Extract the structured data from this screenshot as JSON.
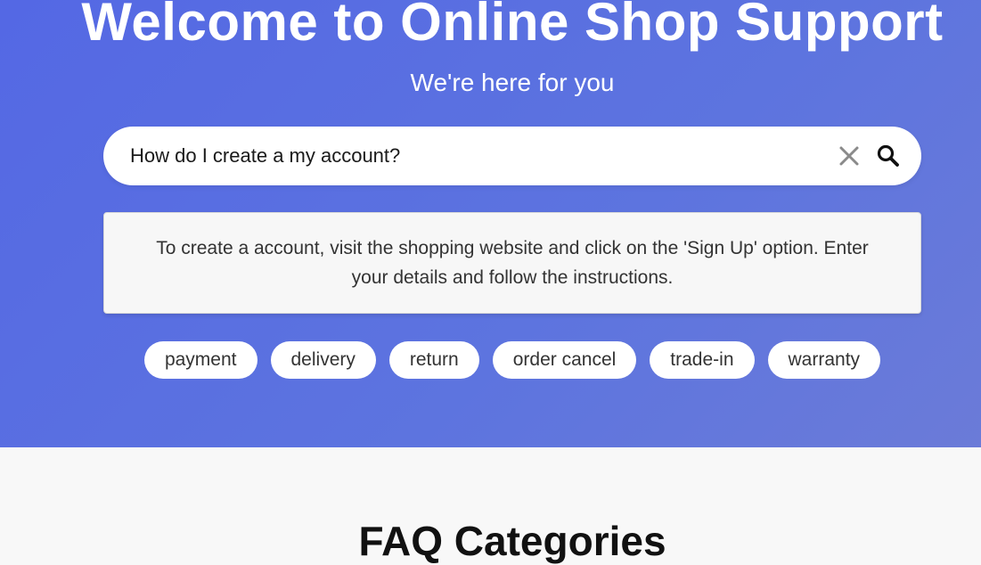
{
  "hero": {
    "title": "Welcome to Online Shop Support",
    "subtitle": "We're here for you",
    "gradient": [
      "#5468e4",
      "#6b7bd8"
    ]
  },
  "search": {
    "value": "How do I create a my account?",
    "clear_icon": "close-icon",
    "search_icon": "search-icon"
  },
  "answer": {
    "text": "To create a account, visit the shopping website and click on the 'Sign Up' option. Enter your details and follow the instructions."
  },
  "tags": [
    {
      "label": "payment"
    },
    {
      "label": "delivery"
    },
    {
      "label": "return"
    },
    {
      "label": "order cancel"
    },
    {
      "label": "trade-in"
    },
    {
      "label": "warranty"
    }
  ],
  "faq": {
    "title": "FAQ Categories"
  }
}
